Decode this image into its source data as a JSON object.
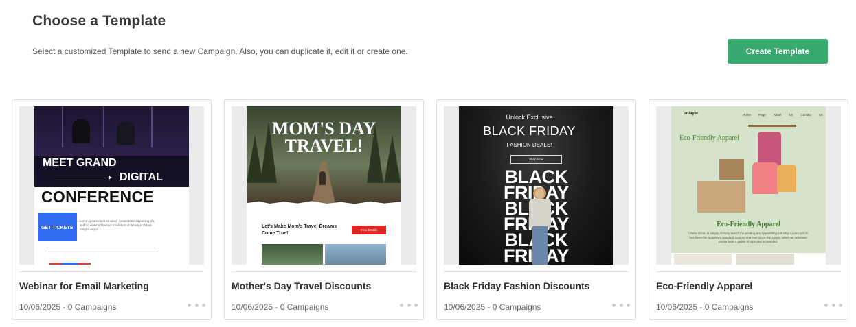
{
  "header": {
    "title": "Choose a Template",
    "subtitle": "Select a customized Template to send a new Campaign. Also, you can duplicate it, edit it or create one.",
    "create_button_label": "Create Template"
  },
  "colors": {
    "accent": "#38a96f",
    "card_border": "#dcdcdc"
  },
  "templates": [
    {
      "name": "Webinar for Email Marketing",
      "meta": "10/06/2025 - 0 Campaigns",
      "preview": {
        "headline_a": "MEET GRAND",
        "headline_b": "DIGITAL",
        "headline_c": "CONFERENCE",
        "cta": "GET TICKETS",
        "body": "Lorem ipsum dolor sit amet, consectetur adipiscing elit, sed do eiusmod tempor incididunt ut labore et dolore magna aliqua."
      }
    },
    {
      "name": "Mother's Day Travel Discounts",
      "meta": "10/06/2025 - 0 Campaigns",
      "preview": {
        "title": "MOM'S DAY TRAVEL!",
        "tagline": "Let's Make Mom's Travel Dreams Come True!",
        "button": "View Details"
      }
    },
    {
      "name": "Black Friday Fashion Discounts",
      "meta": "10/06/2025 - 0 Campaigns",
      "preview": {
        "line_a": "Unlock Exclusive",
        "line_b": "BLACK FRIDAY",
        "line_c": "FASHION DEALS!",
        "button": "Shop Now",
        "repeat_1": "BLACK",
        "repeat_2": "FRIDAY",
        "repeat_3": "BLACK",
        "repeat_4": "FRIDAY",
        "repeat_5": "BLACK",
        "repeat_6": "FRIDAY"
      }
    },
    {
      "name": "Eco-Friendly Apparel",
      "meta": "10/06/2025 - 0 Campaigns",
      "preview": {
        "logo": "unlayer",
        "nav": "Home Page About Us Contact Us",
        "hero_title": "Eco-Friendly Apparel",
        "band_title": "Eco-Friendly Apparel",
        "band_text": "Lorem Ipsum is simply dummy text of the printing and typesetting industry. Lorem Ipsum has been the industry's standard dummy text ever since the 1500s, when an unknown printer took a galley of type and scrambled."
      }
    }
  ]
}
